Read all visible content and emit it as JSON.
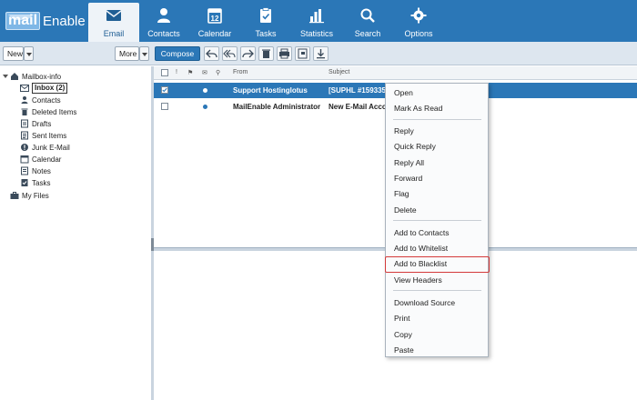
{
  "app": {
    "logo_mail": "mail",
    "logo_enable": "Enable",
    "accent": "#2b77b7"
  },
  "nav": {
    "tabs": [
      {
        "label": "Email",
        "icon": "envelope-icon",
        "active": true
      },
      {
        "label": "Contacts",
        "icon": "person-icon",
        "active": false
      },
      {
        "label": "Calendar",
        "icon": "calendar-icon",
        "active": false,
        "icon_number": "12"
      },
      {
        "label": "Tasks",
        "icon": "clipboard-check-icon",
        "active": false
      },
      {
        "label": "Statistics",
        "icon": "bar-chart-icon",
        "active": false
      },
      {
        "label": "Search",
        "icon": "magnifier-icon",
        "active": false
      },
      {
        "label": "Options",
        "icon": "gear-icon",
        "active": false
      }
    ]
  },
  "toolbar": {
    "new_label": "New",
    "more_label": "More",
    "compose_label": "Compose",
    "icons": [
      "reply-icon",
      "reply-all-icon",
      "forward-icon",
      "delete-icon",
      "print-icon",
      "flag-icon",
      "download-icon"
    ]
  },
  "folders": {
    "root": "Mailbox-info",
    "items": [
      {
        "label": "Inbox (2)",
        "icon": "inbox-icon",
        "selected": true
      },
      {
        "label": "Contacts",
        "icon": "contacts-icon"
      },
      {
        "label": "Deleted Items",
        "icon": "trash-icon"
      },
      {
        "label": "Drafts",
        "icon": "drafts-icon"
      },
      {
        "label": "Sent Items",
        "icon": "sent-icon"
      },
      {
        "label": "Junk E-Mail",
        "icon": "junk-icon"
      },
      {
        "label": "Calendar",
        "icon": "calendar-icon"
      },
      {
        "label": "Notes",
        "icon": "notes-icon"
      },
      {
        "label": "Tasks",
        "icon": "tasks-icon"
      }
    ],
    "my_files": "My Files"
  },
  "message_list": {
    "columns": {
      "from": "From",
      "subject": "Subject"
    },
    "rows": [
      {
        "from": "Support Hostinglotus",
        "subject": "[SUPHL #159335",
        "selected": true,
        "checked": true
      },
      {
        "from": "MailEnable Administrator",
        "subject": "New E-Mail Acco",
        "selected": false,
        "checked": false
      }
    ]
  },
  "context_menu": {
    "items": [
      "Open",
      "Mark As Read",
      "Reply",
      "Quick Reply",
      "Reply All",
      "Forward",
      "Flag",
      "Delete",
      "Add to Contacts",
      "Add to Whitelist",
      "Add to Blacklist",
      "View Headers",
      "Download Source",
      "Print",
      "Copy",
      "Paste"
    ],
    "highlighted": "Add to Blacklist",
    "highlight_color": "#d43a3a"
  }
}
